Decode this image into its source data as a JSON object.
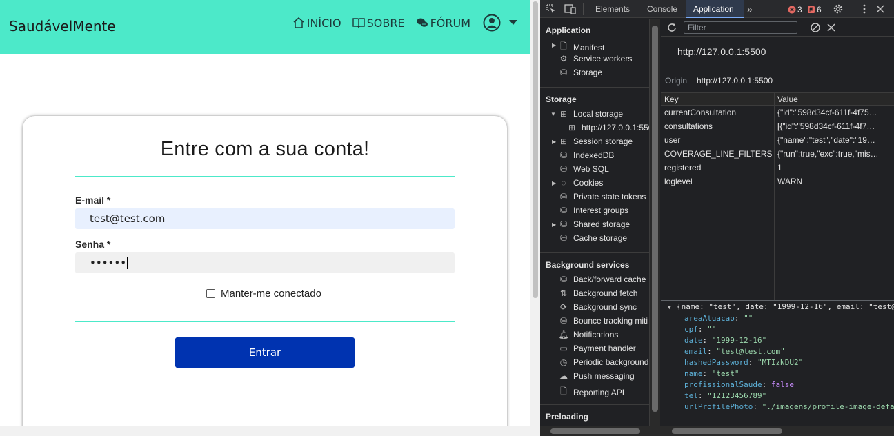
{
  "site": {
    "brand": "SaudávelMente",
    "nav": [
      {
        "label": "INÍCIO",
        "icon": "home-icon"
      },
      {
        "label": "SOBRE",
        "icon": "book-icon"
      },
      {
        "label": "FÓRUM",
        "icon": "chat-icon"
      }
    ]
  },
  "login": {
    "title": "Entre com a sua conta!",
    "email_label": "E-mail *",
    "email_value": "test@test.com",
    "password_label": "Senha *",
    "password_value": "••••••",
    "remember_label": "Manter-me conectado",
    "submit_label": "Entrar"
  },
  "devtools": {
    "tabs": [
      "Elements",
      "Console",
      "Application"
    ],
    "active_tab": "Application",
    "errors": "3",
    "warnings": "6",
    "sidebar": {
      "app_section": "Application",
      "app_items": [
        "Manifest",
        "Service workers",
        "Storage"
      ],
      "storage_section": "Storage",
      "storage_items": [
        "Local storage",
        "http://127.0.0.1:5500",
        "Session storage",
        "IndexedDB",
        "Web SQL",
        "Cookies",
        "Private state tokens",
        "Interest groups",
        "Shared storage",
        "Cache storage"
      ],
      "bg_section": "Background services",
      "bg_items": [
        "Back/forward cache",
        "Background fetch",
        "Background sync",
        "Bounce tracking miti",
        "Notifications",
        "Payment handler",
        "Periodic background",
        "Push messaging",
        "Reporting API"
      ],
      "preload_section": "Preloading"
    },
    "filter_placeholder": "Filter",
    "origin_url": "http://127.0.0.1:5500",
    "origin_label": "Origin",
    "origin_value": "http://127.0.0.1:5500",
    "table": {
      "headers": [
        "Key",
        "Value"
      ],
      "rows": [
        {
          "key": "currentConsultation",
          "value": "{\"id\":\"598d34cf-611f-4f75…"
        },
        {
          "key": "consultations",
          "value": "[{\"id\":\"598d34cf-611f-4f7…"
        },
        {
          "key": "user",
          "value": "{\"name\":\"test\",\"date\":\"19…"
        },
        {
          "key": "COVERAGE_LINE_FILTERS",
          "value": "{\"run\":true,\"exc\":true,\"mis…"
        },
        {
          "key": "registered",
          "value": "1"
        },
        {
          "key": "loglevel",
          "value": "WARN"
        }
      ]
    },
    "preview": {
      "head": "{name: \"test\", date: \"1999-12-16\", email: \"test@",
      "lines": [
        {
          "k": "areaAtuacao",
          "v": "\"\"",
          "t": "str"
        },
        {
          "k": "cpf",
          "v": "\"\"",
          "t": "str"
        },
        {
          "k": "date",
          "v": "\"1999-12-16\"",
          "t": "str"
        },
        {
          "k": "email",
          "v": "\"test@test.com\"",
          "t": "str"
        },
        {
          "k": "hashedPassword",
          "v": "\"MTIzNDU2\"",
          "t": "str"
        },
        {
          "k": "name",
          "v": "\"test\"",
          "t": "str"
        },
        {
          "k": "profissionalSaude",
          "v": "false",
          "t": "bool"
        },
        {
          "k": "tel",
          "v": "\"12123456789\"",
          "t": "str"
        },
        {
          "k": "urlProfilePhoto",
          "v": "\"./imagens/profile-image-defa",
          "t": "str"
        }
      ]
    }
  },
  "colors": {
    "accent": "#4ce9c9",
    "button": "#0033b0",
    "devtools_bg": "#202124"
  }
}
